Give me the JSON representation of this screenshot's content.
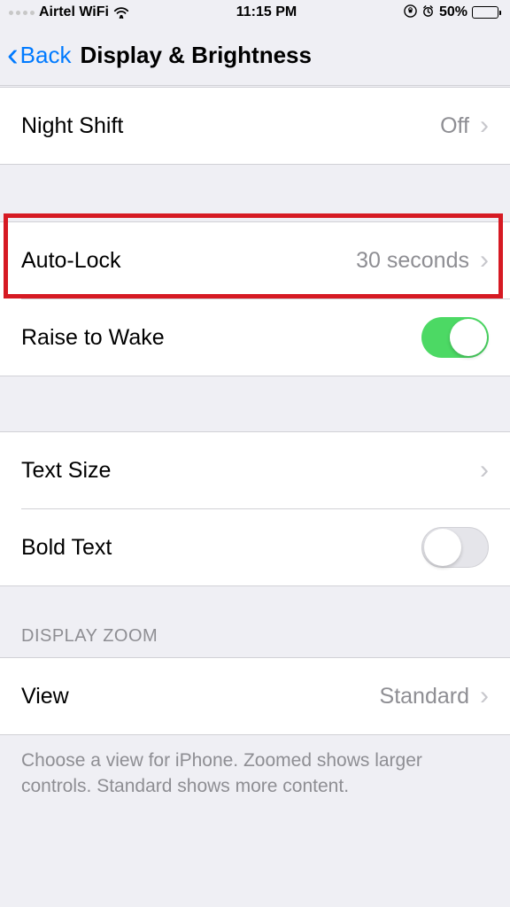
{
  "statusBar": {
    "carrier": "Airtel WiFi",
    "time": "11:15 PM",
    "batteryPercent": "50%"
  },
  "nav": {
    "backLabel": "Back",
    "title": "Display & Brightness"
  },
  "rows": {
    "nightShift": {
      "label": "Night Shift",
      "value": "Off"
    },
    "autoLock": {
      "label": "Auto-Lock",
      "value": "30 seconds"
    },
    "raiseToWake": {
      "label": "Raise to Wake",
      "toggle": true
    },
    "textSize": {
      "label": "Text Size"
    },
    "boldText": {
      "label": "Bold Text",
      "toggle": false
    },
    "view": {
      "label": "View",
      "value": "Standard"
    }
  },
  "sections": {
    "displayZoomHeader": "DISPLAY ZOOM",
    "displayZoomFooter": "Choose a view for iPhone. Zoomed shows larger controls. Standard shows more content."
  }
}
